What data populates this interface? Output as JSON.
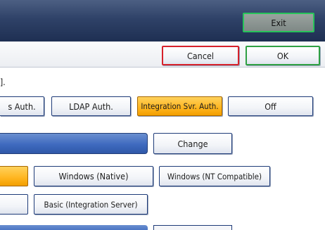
{
  "header": {
    "exit_label": "Exit"
  },
  "commands": {
    "cancel_label": "Cancel",
    "ok_label": "OK"
  },
  "message": {
    "text": "]."
  },
  "auth_methods": {
    "items": [
      {
        "label": "s Auth.",
        "selected": false
      },
      {
        "label": "LDAP Auth.",
        "selected": false
      },
      {
        "label": "Integration Svr. Auth.",
        "selected": true
      },
      {
        "label": "Off",
        "selected": false
      }
    ]
  },
  "server": {
    "change_label": "Change"
  },
  "auth_type": {
    "windows_native": "Windows (Native)",
    "windows_nt": "Windows (NT Compatible)",
    "basic_integration": "Basic (Integration Server)"
  },
  "colors": {
    "header_bg": "#2f4268",
    "selected_bg": "#ffb51f",
    "section_bar": "#3f6abf",
    "cancel_border": "#d7212b",
    "ok_border": "#2fa043",
    "exit_border": "#27c45a"
  }
}
